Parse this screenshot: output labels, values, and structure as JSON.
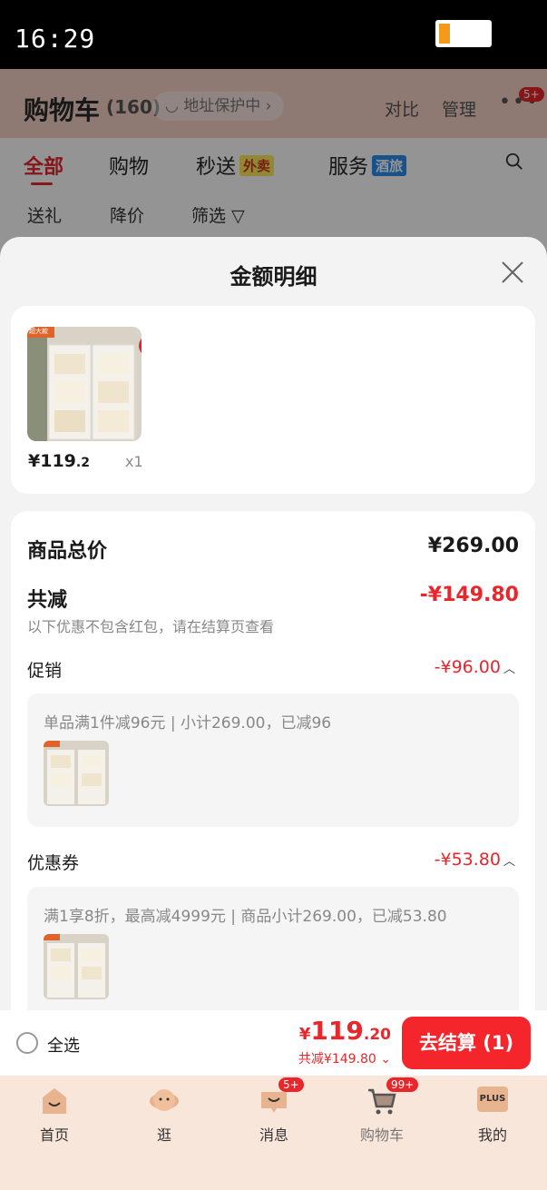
{
  "status_bar": {
    "time": "16:29"
  },
  "cart_header": {
    "title": "购物车",
    "count": "(160)",
    "address_protect": "地址保护中",
    "compare": "对比",
    "manage": "管理",
    "more_badge": "5+"
  },
  "tabs": [
    {
      "label": "全部"
    },
    {
      "label": "购物"
    },
    {
      "label": "秒送",
      "tag": "外卖"
    },
    {
      "label": "服务",
      "tag": "酒旅"
    }
  ],
  "filters": [
    "送礼",
    "降价",
    "筛选"
  ],
  "sheet": {
    "title": "金额明细",
    "product": {
      "price_main": "¥119",
      "price_dec": ".2",
      "qty": "x1",
      "thumb_badge": "超大款"
    },
    "subtotal_label": "商品总价",
    "subtotal_value": "¥269.00",
    "discount_label": "共减",
    "discount_value": "-¥149.80",
    "discount_note": "以下优惠不包含红包，请在结算页查看",
    "promo": {
      "label": "促销",
      "value": "-¥96.00",
      "desc": "单品满1件减96元 | 小计269.00，已减96"
    },
    "coupon": {
      "label": "优惠券",
      "value": "-¥53.80",
      "desc": "满1享8折，最高减4999元 | 商品小计269.00，已减53.80"
    }
  },
  "checkout": {
    "select_all": "全选",
    "total_sym": "¥",
    "total_main": "119",
    "total_dec": ".20",
    "savings": "共减¥149.80",
    "pay_label": "去结算 (1)"
  },
  "bottom_nav": [
    {
      "label": "首页"
    },
    {
      "label": "逛"
    },
    {
      "label": "消息",
      "badge": "5+"
    },
    {
      "label": "购物车",
      "badge": "99+"
    },
    {
      "label": "我的",
      "icon_text": "PLUS"
    }
  ],
  "colors": {
    "accent": "#e8262b",
    "pay_button": "#f4262c"
  }
}
